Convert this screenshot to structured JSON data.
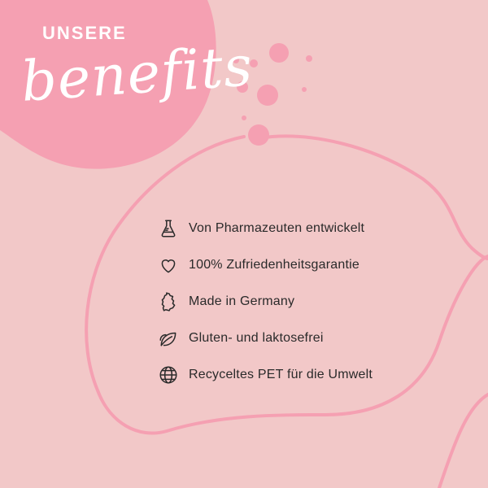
{
  "heading": {
    "kicker": "UNSERE",
    "script": "benefits"
  },
  "colors": {
    "background": "#f2c8c8",
    "accent": "#f5a0b2",
    "text": "#2a2a2a"
  },
  "benefits": [
    {
      "icon": "flask-icon",
      "label": "Von Pharmazeuten entwickelt"
    },
    {
      "icon": "heart-icon",
      "label": "100% Zufriedenheitsgarantie"
    },
    {
      "icon": "germany-map-icon",
      "label": "Made in Germany"
    },
    {
      "icon": "leaf-icon",
      "label": "Gluten- und laktosefrei"
    },
    {
      "icon": "globe-icon",
      "label": "Recyceltes PET für die Umwelt"
    }
  ]
}
